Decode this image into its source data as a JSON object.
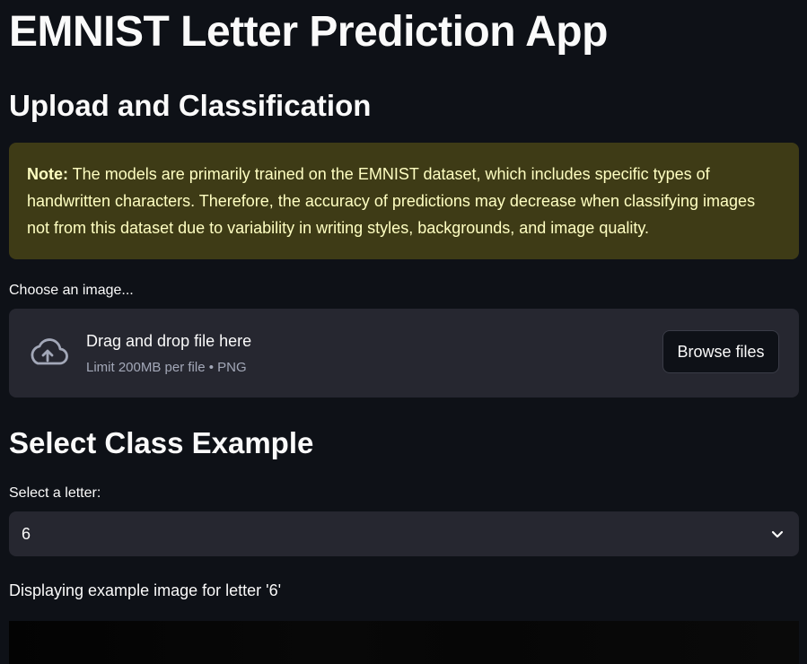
{
  "app": {
    "title": "EMNIST Letter Prediction App"
  },
  "upload_section": {
    "heading": "Upload and Classification",
    "note_label": "Note:",
    "note_text": " The models are primarily trained on the EMNIST dataset, which includes specific types of handwritten characters. Therefore, the accuracy of predictions may decrease when classifying images not from this dataset due to variability in writing styles, backgrounds, and image quality.",
    "uploader_label": "Choose an image...",
    "dropzone_title": "Drag and drop file here",
    "dropzone_limit": "Limit 200MB per file • PNG",
    "browse_label": "Browse files",
    "icon": "cloud-upload-icon"
  },
  "class_section": {
    "heading": "Select Class Example",
    "select_label": "Select a letter:",
    "selected_value": "6",
    "chevron_icon": "chevron-down-icon",
    "display_text": "Displaying example image for letter '6'"
  },
  "colors": {
    "background": "#0e1117",
    "surface": "#262730",
    "note_bg": "#3e3b16",
    "note_text": "#ffffc2"
  }
}
